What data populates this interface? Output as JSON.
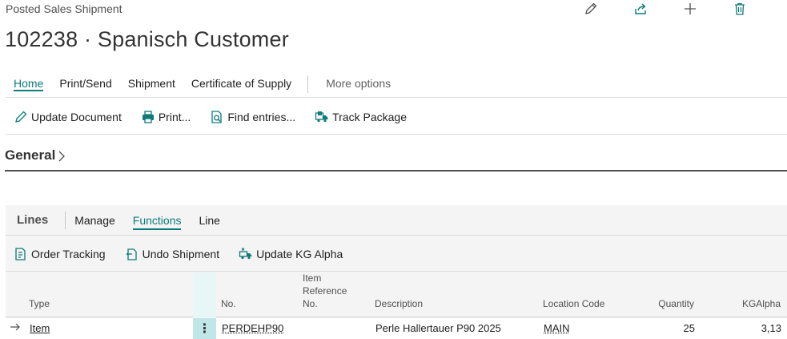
{
  "page": {
    "type_label": "Posted Sales Shipment",
    "title": "102238 · Spanisch Customer"
  },
  "top_actions": {
    "edit_icon": "pencil-icon",
    "share_icon": "share-icon",
    "new_icon": "plus-icon",
    "delete_icon": "trash-icon"
  },
  "action_tabs": [
    {
      "label": "Home",
      "active": true
    },
    {
      "label": "Print/Send",
      "active": false
    },
    {
      "label": "Shipment",
      "active": false
    },
    {
      "label": "Certificate of Supply",
      "active": false
    }
  ],
  "more_options": "More options",
  "action_buttons": [
    {
      "label": "Update Document",
      "icon": "pencil-icon"
    },
    {
      "label": "Print...",
      "icon": "printer-icon"
    },
    {
      "label": "Find entries...",
      "icon": "find-entries-icon"
    },
    {
      "label": "Track Package",
      "icon": "truck-icon"
    }
  ],
  "general": {
    "title": "General"
  },
  "lines": {
    "title": "Lines",
    "tabs": [
      {
        "label": "Manage",
        "active": false
      },
      {
        "label": "Functions",
        "active": true
      },
      {
        "label": "Line",
        "active": false
      }
    ],
    "actions": [
      {
        "label": "Order Tracking",
        "icon": "order-tracking-icon"
      },
      {
        "label": "Undo Shipment",
        "icon": "undo-shipment-icon"
      },
      {
        "label": "Update KG Alpha",
        "icon": "truck-update-icon"
      }
    ],
    "columns": {
      "type": "Type",
      "no": "No.",
      "item_ref_1": "Item",
      "item_ref_2": "Reference",
      "item_ref_3": "No.",
      "description": "Description",
      "location": "Location Code",
      "quantity": "Quantity",
      "kgalpha": "KGAlpha"
    },
    "rows": [
      {
        "type": "Item",
        "no": "PERDEHP90",
        "item_ref": "",
        "description": "Perle Hallertauer P90 2025",
        "location": "MAIN",
        "quantity": "25",
        "kgalpha": "3,13"
      }
    ]
  },
  "colors": {
    "accent": "#0f7a7a",
    "row_menu_bg": "#bfe6e9",
    "panel_bg": "#f4f4f4"
  }
}
